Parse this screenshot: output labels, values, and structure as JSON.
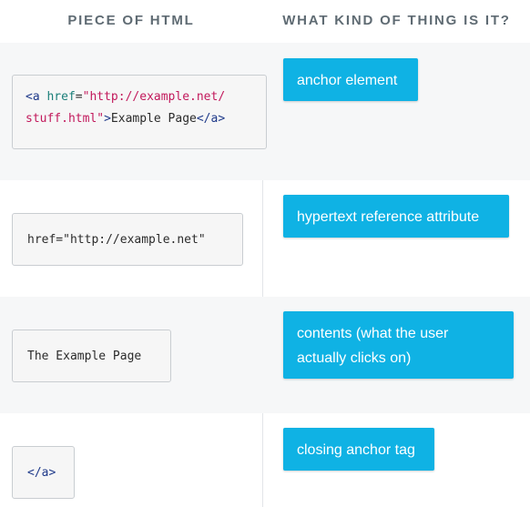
{
  "header": {
    "left": "PIECE OF HTML",
    "right": "WHAT KIND OF THING IS IT?"
  },
  "rows": [
    {
      "code": {
        "l1_tag_open": "<a",
        "l1_space": " ",
        "l1_attr": "href",
        "l1_eq": "=",
        "l1_str": "\"http://example.net/",
        "l2_str": "stuff.html\"",
        "l2_tag_close": ">",
        "l2_text": "Example Page",
        "l2_end_tag": "</a>"
      },
      "answer": "anchor element"
    },
    {
      "code": "href=\"http://example.net\"",
      "answer": "hypertext reference attribute"
    },
    {
      "code": "The Example Page",
      "answer": "contents (what the user actually clicks on)"
    },
    {
      "code": "</a>",
      "answer": "closing anchor tag"
    }
  ]
}
